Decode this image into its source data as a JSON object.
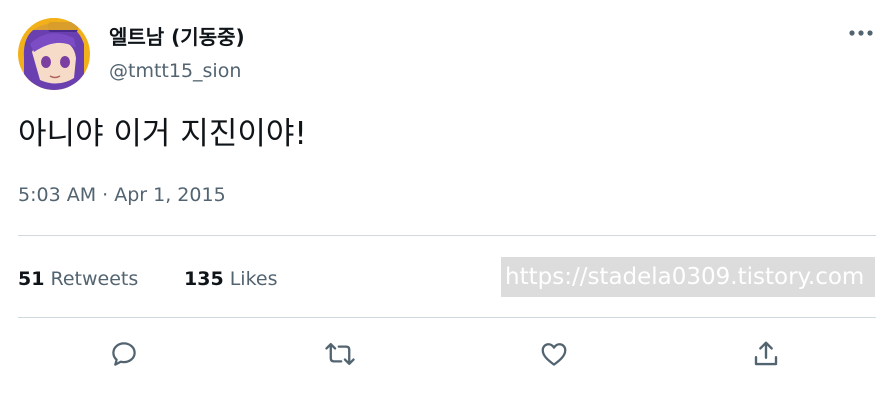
{
  "author": {
    "display_name": "엘트남 (기동중)",
    "handle": "@tmtt15_sion",
    "avatar_icon": "avatar-image"
  },
  "tweet": {
    "text": "아니야 이거 지진이야!",
    "time": "5:03 AM",
    "separator": " · ",
    "date": "Apr 1, 2015"
  },
  "stats": {
    "retweets_count": "51",
    "retweets_label": "Retweets",
    "likes_count": "135",
    "likes_label": "Likes"
  },
  "watermark": {
    "text": "https://stadela0309.tistory.com"
  },
  "actions": [
    {
      "name": "reply",
      "icon": "reply-icon"
    },
    {
      "name": "retweet",
      "icon": "retweet-icon"
    },
    {
      "name": "like",
      "icon": "heart-icon"
    },
    {
      "name": "share",
      "icon": "share-icon"
    }
  ],
  "colors": {
    "text_primary": "#0f1419",
    "text_secondary": "#536471",
    "divider": "#cfd9de",
    "icon": "#536471",
    "watermark_bg": "#dcdcdc"
  }
}
